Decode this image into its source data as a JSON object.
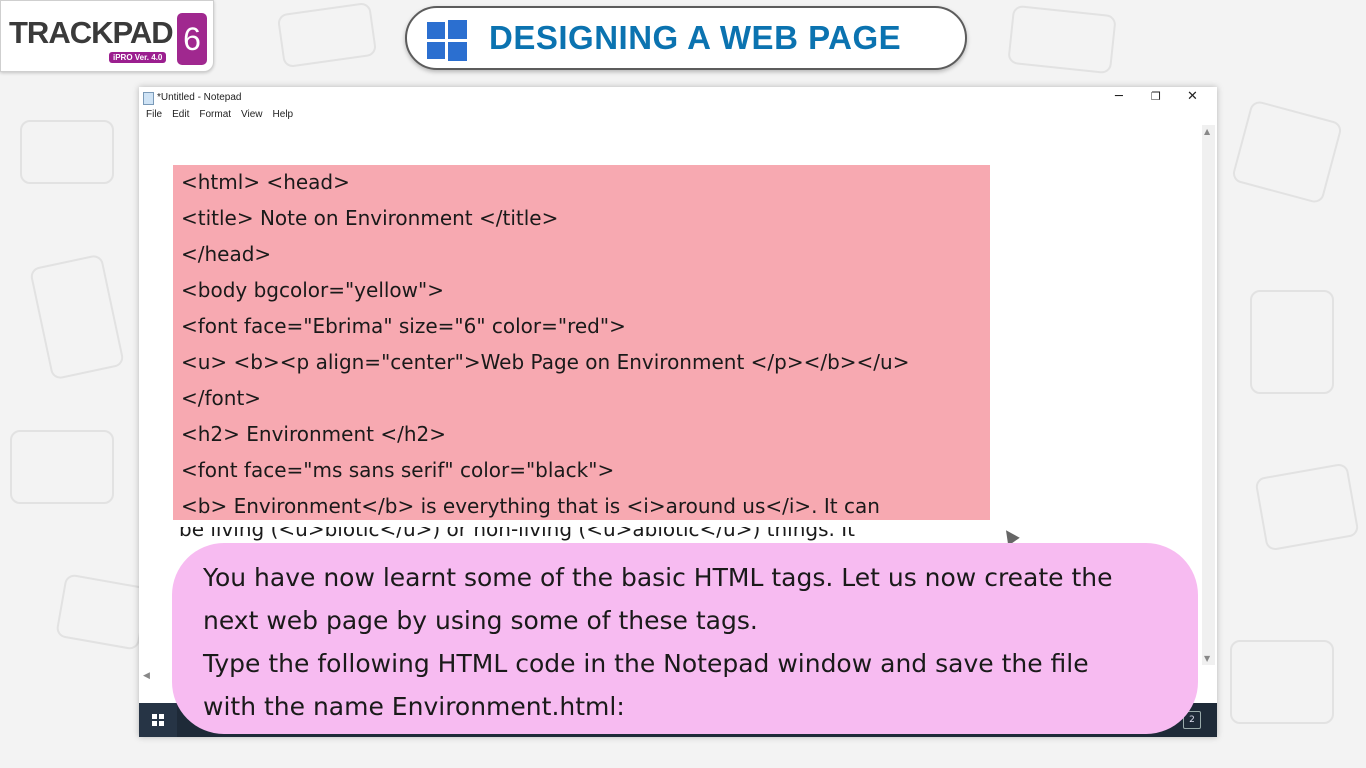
{
  "logo": {
    "text": "TRACKPAD",
    "sub": "iPRO Ver. 4.0",
    "number": "6"
  },
  "banner": {
    "title": "DESIGNING A WEB PAGE",
    "brand_color": "#0b73b0",
    "icon": "windows-logo-icon"
  },
  "notepad": {
    "window_title": "*Untitled - Notepad",
    "menu": [
      "File",
      "Edit",
      "Format",
      "View",
      "Help"
    ],
    "controls": {
      "minimize": "─",
      "restore": "❐",
      "close": "✕"
    },
    "highlight_color": "#f7a9b1",
    "code_lines": [
      "<html> <head>",
      "<title> Note on Environment </title>",
      "</head>",
      "<body bgcolor=\"yellow\">",
      "<font face=\"Ebrima\" size=\"6\" color=\"red\">",
      "<u> <b><p align=\"center\">Web Page on Environment </p></b></u>",
      "</font>",
      "<h2> Environment </h2>",
      "<font face=\"ms sans serif\" color=\"black\">",
      "<b> Environment</b> is everything that is <i>around us</i>. It can"
    ],
    "partial_line": "be living (<u>biotic</u>) or non-living (<u>abiotic</u>) things. It"
  },
  "taskbar": {
    "start_icon": "windows-start-icon",
    "tray_badge": "2"
  },
  "bubble": {
    "color": "#f7bbf1",
    "lines": [
      "You have now learnt some of the basic HTML tags. Let us now create the",
      "next web page by using some of these tags.",
      "Type the following HTML code in the Notepad window and save the file",
      "with the name Environment.html:"
    ]
  }
}
